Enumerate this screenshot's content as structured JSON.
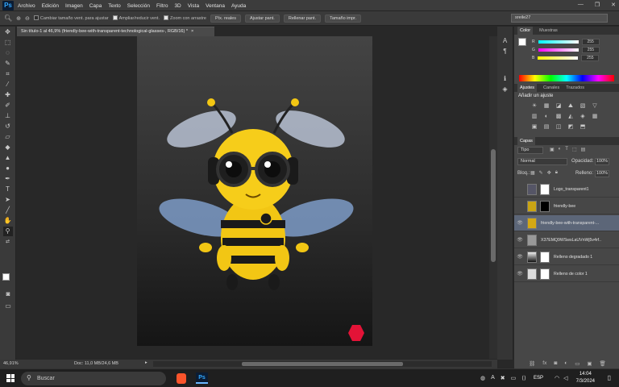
{
  "app": {
    "logo": "Ps",
    "menus": [
      "Archivo",
      "Edición",
      "Imagen",
      "Capa",
      "Texto",
      "Selección",
      "Filtro",
      "3D",
      "Vista",
      "Ventana",
      "Ayuda"
    ],
    "window_buttons": [
      "—",
      "❐",
      "✕"
    ]
  },
  "options_bar": {
    "check1": "Cambiar tamaño vent. para ajustar",
    "check2": "Ampliar/reducir vent.",
    "check3": "Zoom con arrastre",
    "btn1": "Píx. reales",
    "btn2": "Ajustar pant.",
    "btn3": "Rellenar pant.",
    "btn4": "Tamaño impr.",
    "workspace": "sreile27"
  },
  "document": {
    "tab_title": "Sin título-1 al 46,9% (friendly-bee-with-transparent-technological-glasses-, RGB/16) *"
  },
  "status": {
    "zoom": "46,91%",
    "doc": "Doc: 11,0 MB/24,6 MB"
  },
  "color_panel": {
    "tabs": [
      "Color",
      "Muestras"
    ],
    "r_label": "R",
    "g_label": "G",
    "b_label": "B",
    "r": "255",
    "g": "255",
    "b": "255"
  },
  "adjust_panel": {
    "tabs": [
      "Ajustes",
      "Canales",
      "Trazados"
    ],
    "title": "Añadir un ajuste",
    "icons": [
      "☀",
      "▦",
      "◪",
      "⛰",
      "▧",
      "▽",
      "▥",
      "◐",
      "▩",
      "◭",
      "◈",
      "▦",
      "▣",
      "▤",
      "◫",
      "◩",
      "⬒"
    ]
  },
  "layers_panel": {
    "tab": "Capas",
    "kind": "Tipo",
    "blend": "Normal",
    "opacity_label": "Opacidad:",
    "opacity": "100%",
    "lock_label": "Bloq.:",
    "fill_label": "Relleno:",
    "fill": "100%",
    "layers": [
      {
        "name": "Logo_transparent1",
        "visible": false
      },
      {
        "name": "friendly-bee",
        "visible": false
      },
      {
        "name": "friendly-bee-with-transparent-...",
        "visible": true
      },
      {
        "name": "X37EMQ9WSwsLaUVnWj5v4rf...",
        "visible": true
      },
      {
        "name": "Relleno degradado 1",
        "visible": true
      },
      {
        "name": "Relleno de color 1",
        "visible": true
      }
    ]
  },
  "taskbar": {
    "search": "Buscar",
    "lang": "ESP",
    "time": "14:04",
    "date": "7/3/2024"
  }
}
